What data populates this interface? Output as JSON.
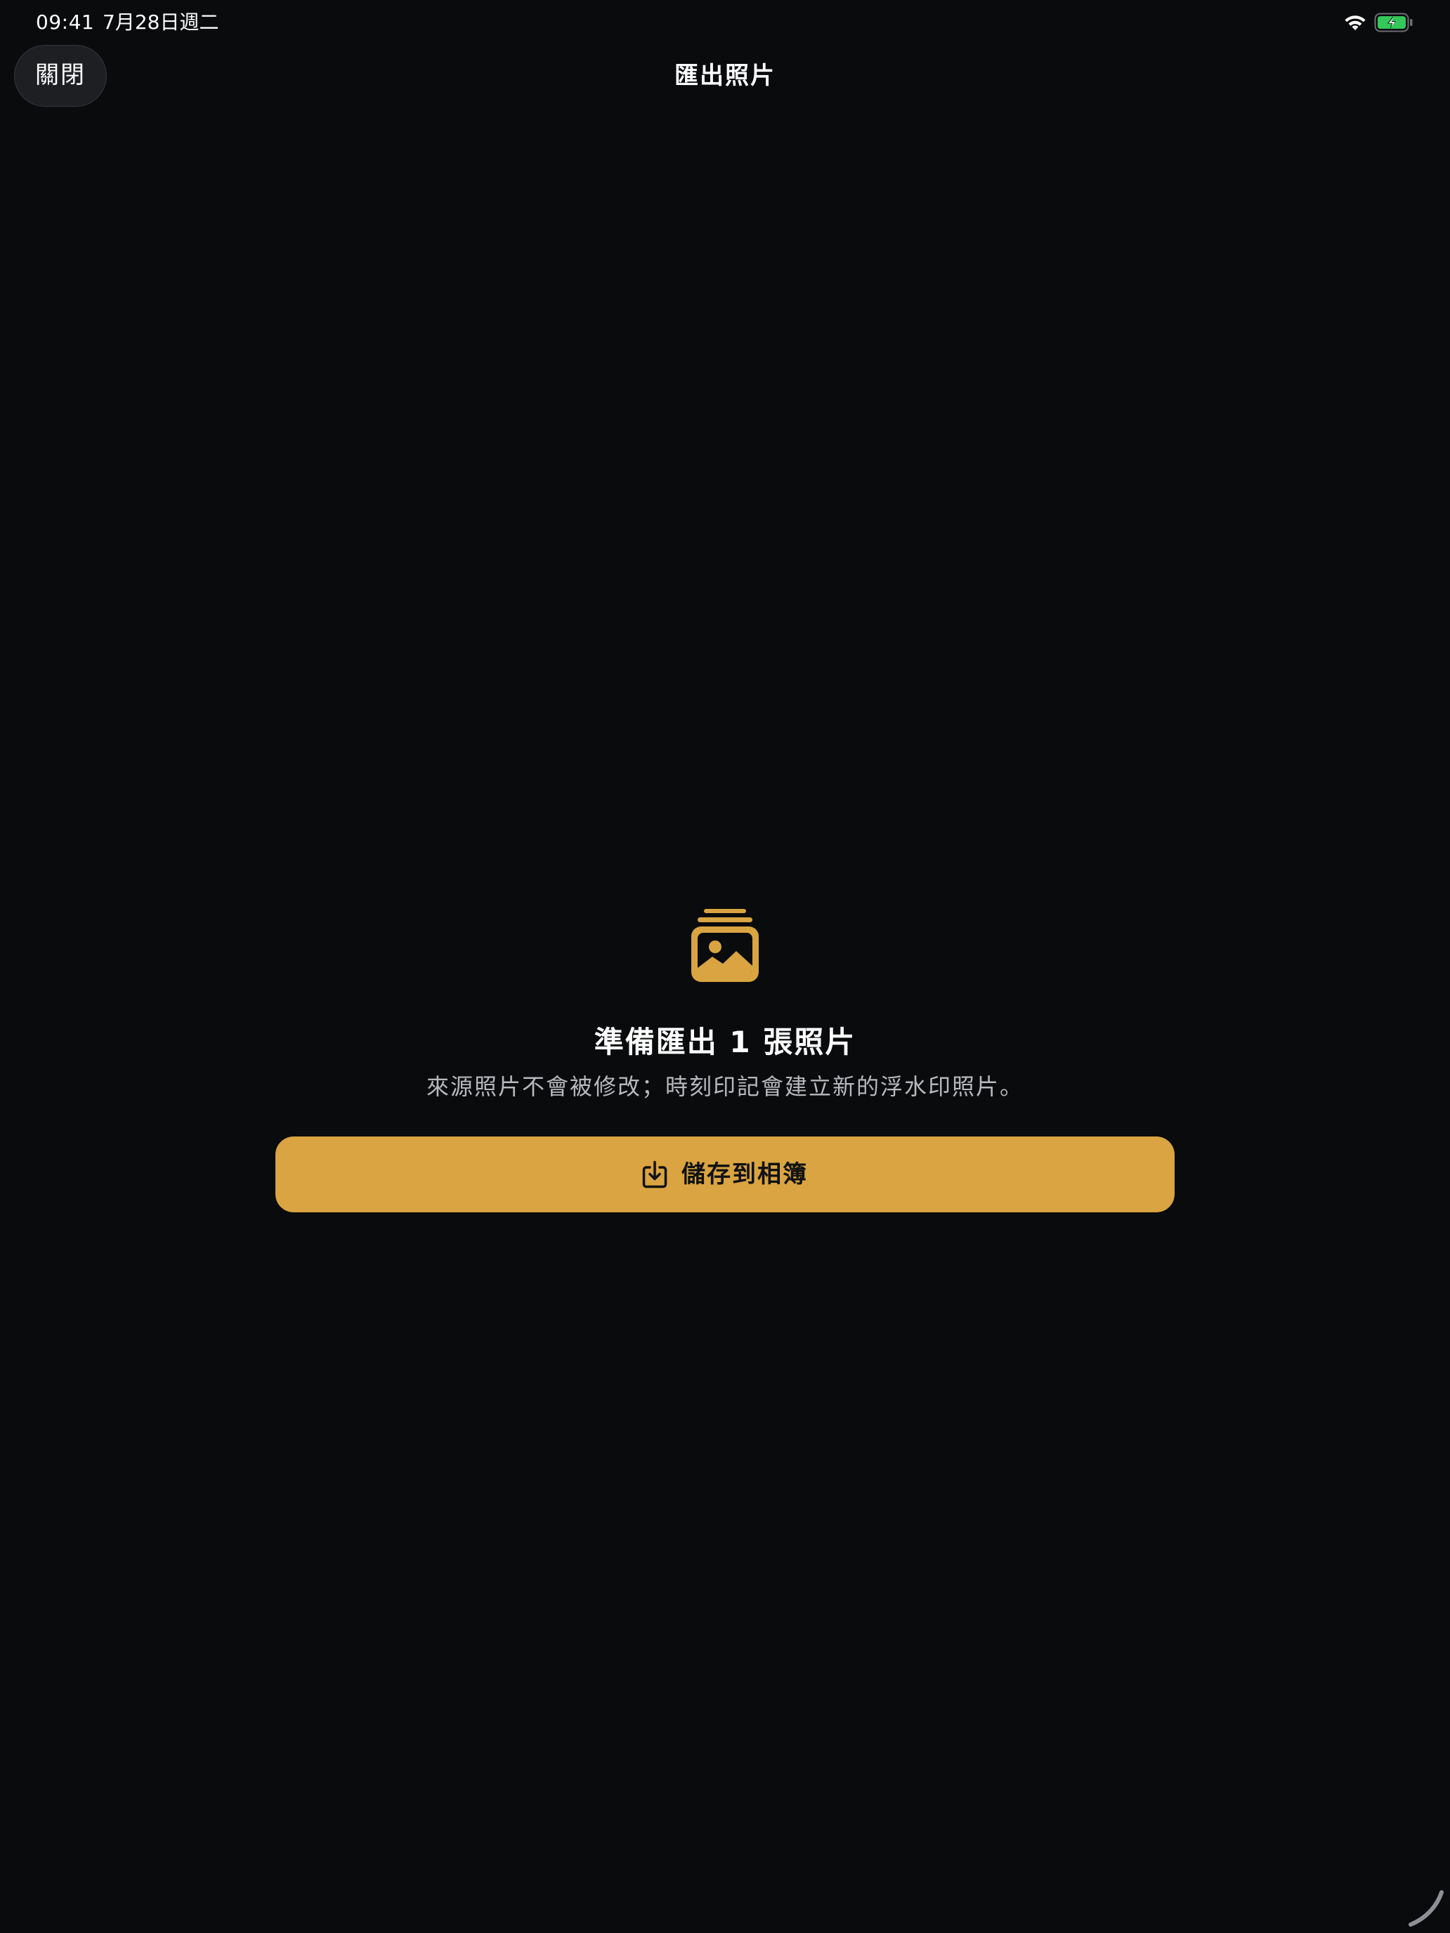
{
  "status_bar": {
    "time": "09:41",
    "date": "7月28日週二",
    "icons": [
      "wifi-icon",
      "battery-charging-icon"
    ]
  },
  "nav": {
    "close_label": "關閉",
    "title": "匯出照片"
  },
  "content": {
    "icon": "photo-stack-icon",
    "heading": "準備匯出 1 張照片",
    "description": "來源照片不會被修改；時刻印記會建立新的浮水印照片。"
  },
  "save_button": {
    "icon": "save-download-icon",
    "label": "儲存到相簿"
  },
  "colors": {
    "background": "#0a0b0d",
    "accent": "#d9a441",
    "battery_green": "#34c759"
  }
}
